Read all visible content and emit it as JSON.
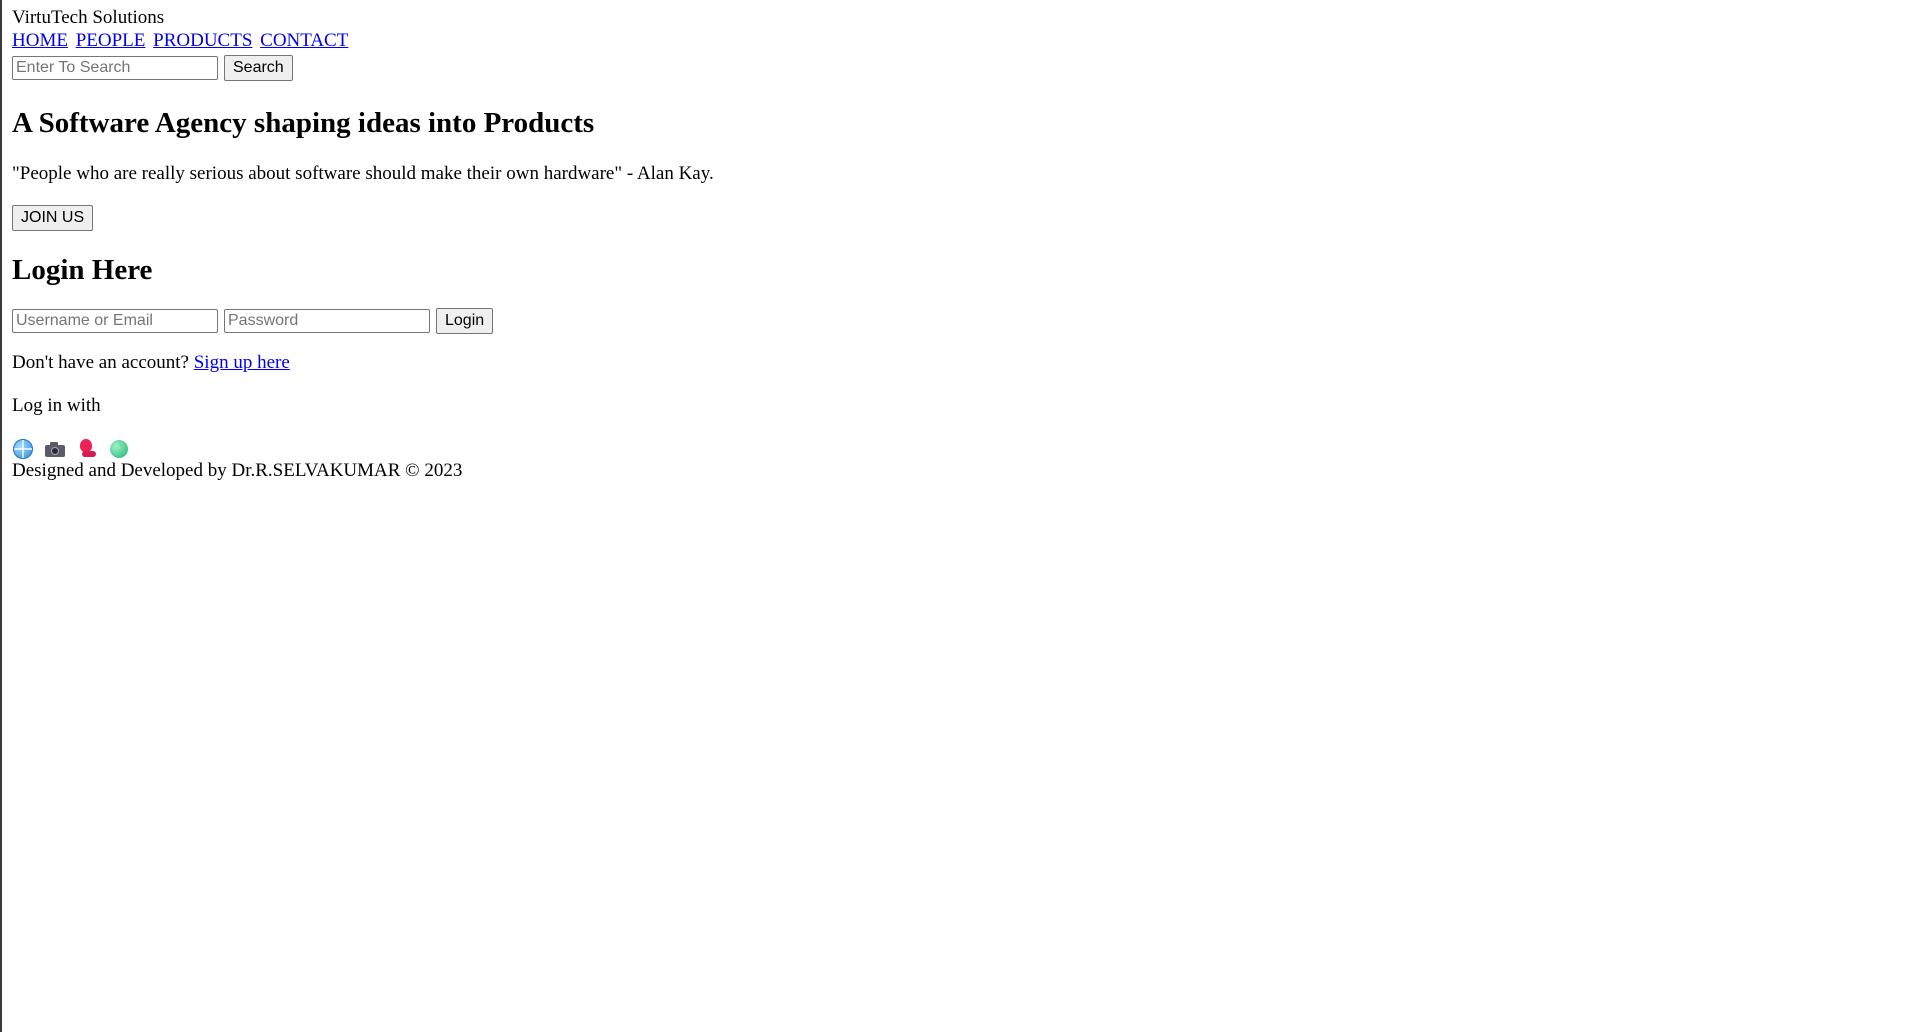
{
  "brand": {
    "name": "VirtuTech Solutions"
  },
  "nav": {
    "items": [
      "HOME",
      "PEOPLE",
      "PRODUCTS",
      "CONTACT"
    ]
  },
  "search": {
    "placeholder": "Enter To Search",
    "value": "",
    "button_label": "Search"
  },
  "hero": {
    "title": "A Software Agency shaping ideas into Products",
    "quote": "\"People who are really serious about software should make their own hardware\" - Alan Kay.",
    "join_label": "JOIN US"
  },
  "login": {
    "title": "Login Here",
    "username_placeholder": "Username or Email",
    "password_placeholder": "Password",
    "button_label": "Login",
    "signup_prompt": "Don't have an account?",
    "signup_link": "Sign up here",
    "login_with": "Log in with",
    "social_icons": [
      "globe-icon",
      "camera-icon",
      "pin-icon",
      "green-ball-icon"
    ]
  },
  "footer": {
    "text": "Designed and Developed by Dr.R.SELVAKUMAR © 2023"
  },
  "colors": {
    "link": "#0000ee",
    "button_bg": "#efefef",
    "border": "#767676"
  }
}
